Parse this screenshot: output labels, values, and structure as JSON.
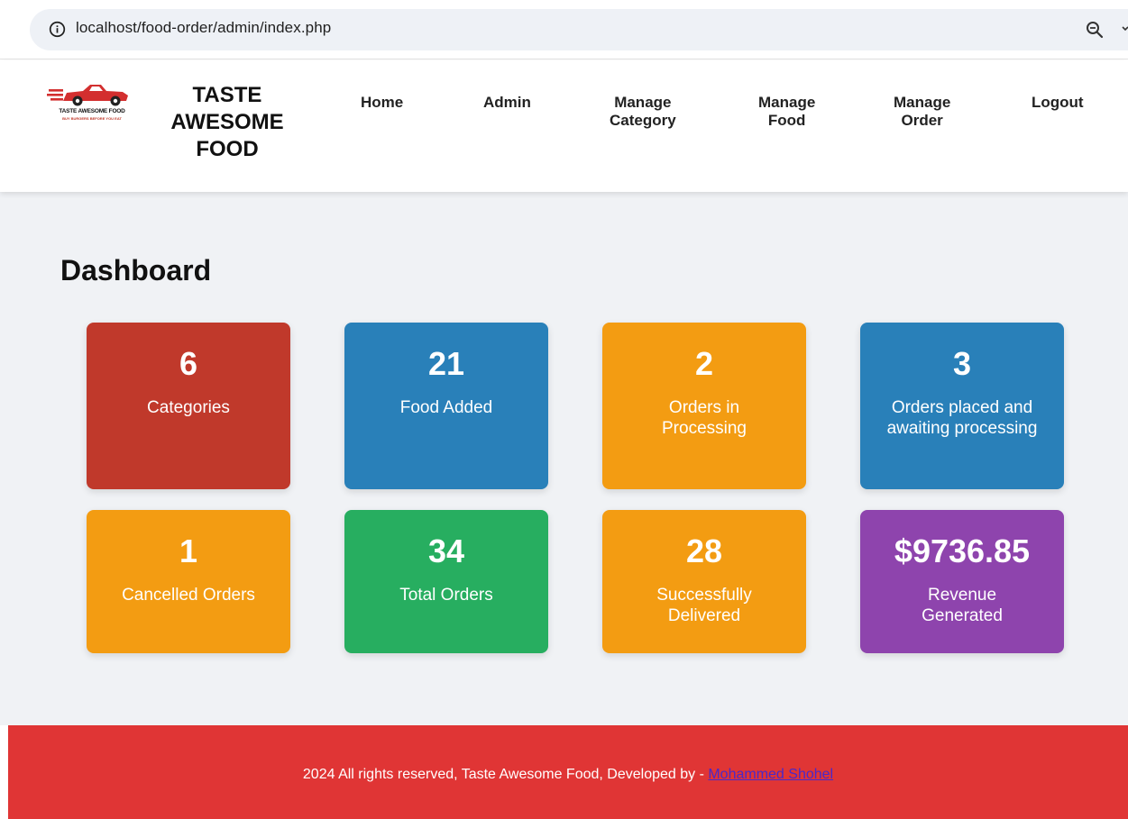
{
  "browser": {
    "url": "localhost/food-order/admin/index.php",
    "icons": [
      "info-icon",
      "zoom-icon"
    ]
  },
  "header": {
    "logo": {
      "line1": "TASTE AWESOME FOOD",
      "line2": "BUY BURGERS BEFORE YOU EAT"
    },
    "brand_line1": "TASTE",
    "brand_line2": "AWESOME",
    "brand_line3": "FOOD",
    "nav": [
      {
        "line1": "Home",
        "line2": ""
      },
      {
        "line1": "Admin",
        "line2": ""
      },
      {
        "line1": "Manage",
        "line2": "Category"
      },
      {
        "line1": "Manage",
        "line2": "Food"
      },
      {
        "line1": "Manage",
        "line2": "Order"
      },
      {
        "line1": "Logout",
        "line2": ""
      }
    ]
  },
  "dashboard": {
    "title": "Dashboard",
    "cards": [
      {
        "value": "6",
        "label": "Categories",
        "color": "#c0392b"
      },
      {
        "value": "21",
        "label": "Food Added",
        "color": "#2980b9"
      },
      {
        "value": "2",
        "label": "Orders in Processing",
        "color": "#f39c12"
      },
      {
        "value": "3",
        "label": "Orders placed and awaiting processing",
        "color": "#2980b9"
      },
      {
        "value": "1",
        "label": "Cancelled Orders",
        "color": "#f39c12"
      },
      {
        "value": "34",
        "label": "Total Orders",
        "color": "#27ae60"
      },
      {
        "value": "28",
        "label": "Successfully Delivered",
        "color": "#f39c12"
      },
      {
        "value": "$9736.85",
        "label": "Revenue Generated",
        "color": "#8e44ad"
      }
    ]
  },
  "footer": {
    "text": "2024 All rights reserved, Taste Awesome Food, Developed by - ",
    "link": "Mohammed Shohel",
    "color": "#e03535"
  }
}
